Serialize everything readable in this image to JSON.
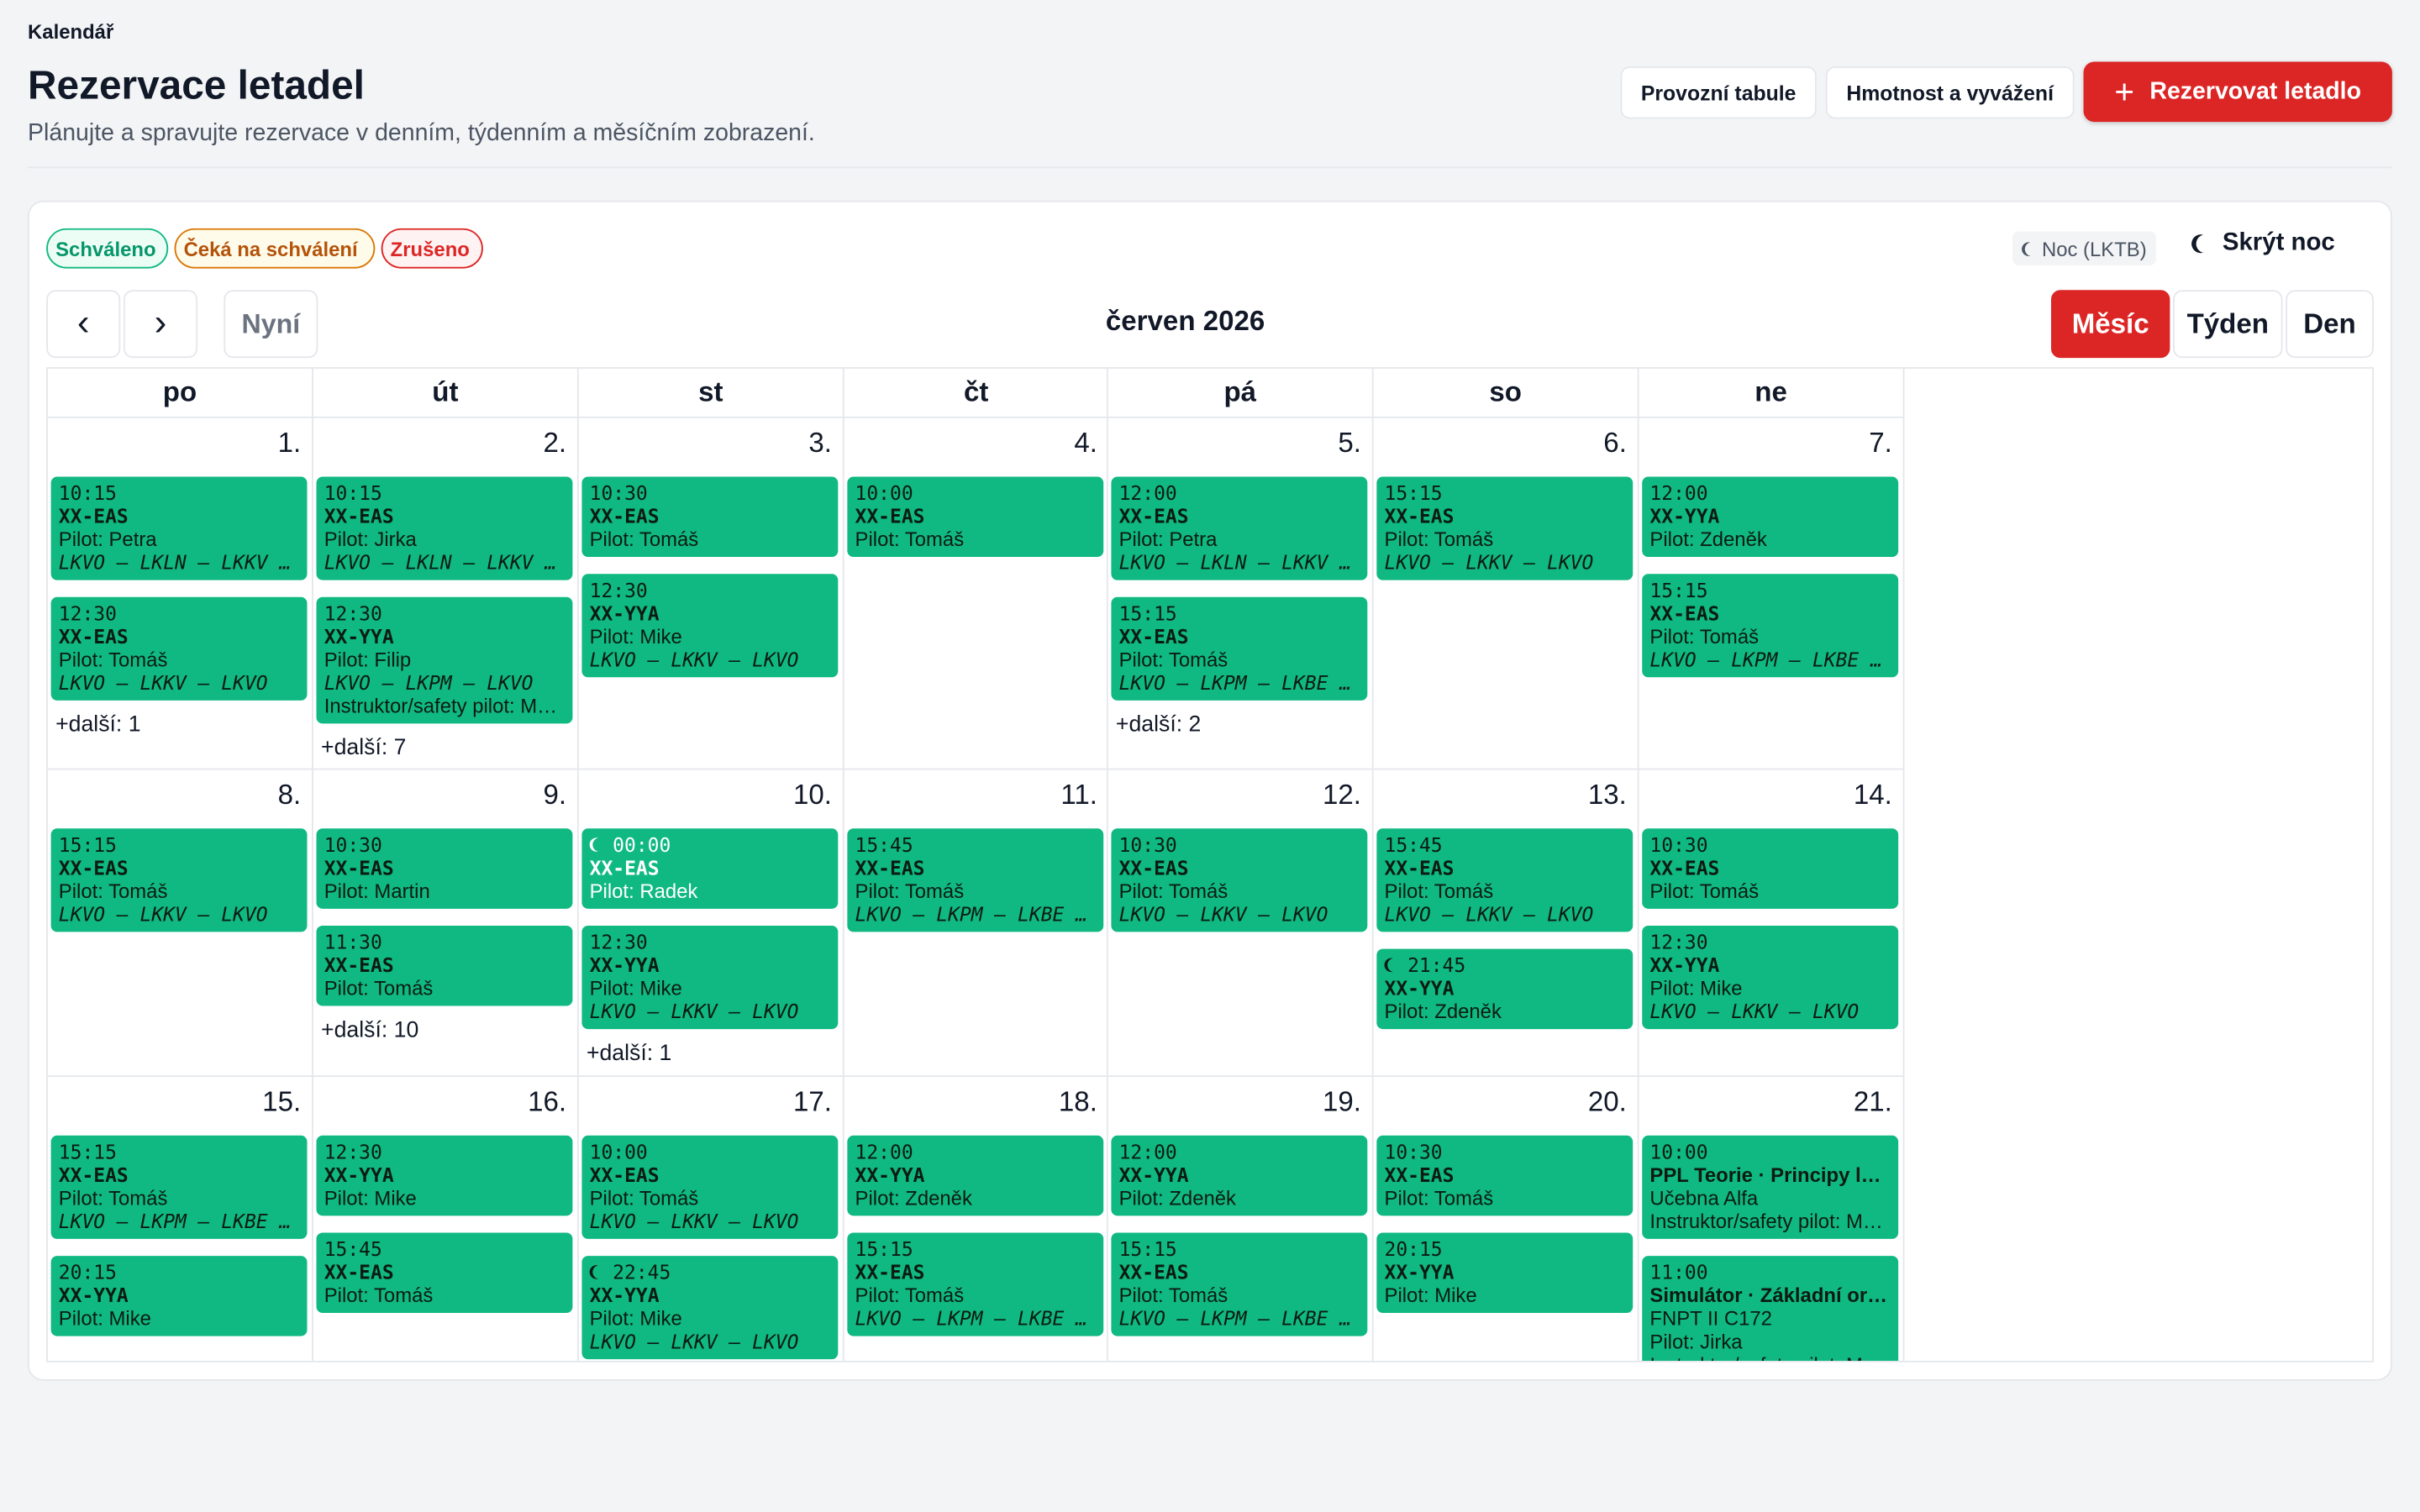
{
  "breadcrumb": "Kalendář",
  "header": {
    "title": "Rezervace letadel",
    "subtitle": "Plánujte a spravujte rezervace v denním, týdenním a měsíčním zobrazení.",
    "btn_board": "Provozní tabule",
    "btn_weight": "Hmotnost a vyvážení",
    "btn_book": "Rezervovat letadlo"
  },
  "legend": {
    "approved": "Schváleno",
    "pending": "Čeká na schválení",
    "cancelled": "Zrušeno",
    "night": "Noc (LKTB)",
    "hide_night": "Skrýt noc"
  },
  "toolbar": {
    "today": "Nyní",
    "month_label": "červen 2026",
    "view_month": "Měsíc",
    "view_week": "Týden",
    "view_day": "Den"
  },
  "colors": {
    "accent": "#dc2626",
    "event": "#10b981",
    "approved": "#059669",
    "pending": "#b45309",
    "cancelled": "#dc2626"
  },
  "days": [
    "po",
    "út",
    "st",
    "čt",
    "pá",
    "so",
    "ne"
  ],
  "weeks": [
    [
      {
        "num": "1.",
        "events": [
          {
            "time": "10:15",
            "plane": "XX-EAS",
            "pilot": "Pilot: Petra",
            "route": "LKVO – LKLN – LKKV – LKVO"
          },
          {
            "time": "12:30",
            "plane": "XX-EAS",
            "pilot": "Pilot: Tomáš",
            "route": "LKVO – LKKV – LKVO"
          }
        ],
        "more": "+další: 1"
      },
      {
        "num": "2.",
        "events": [
          {
            "time": "10:15",
            "plane": "XX-EAS",
            "pilot": "Pilot: Jirka",
            "route": "LKVO – LKLN – LKKV – LKVO"
          },
          {
            "time": "12:30",
            "plane": "XX-YYA",
            "pilot": "Pilot: Filip",
            "route": "LKVO – LKPM – LKVO",
            "extra": "Instruktor/safety pilot: Martin"
          }
        ],
        "more": "+další: 7"
      },
      {
        "num": "3.",
        "events": [
          {
            "time": "10:30",
            "plane": "XX-EAS",
            "pilot": "Pilot: Tomáš"
          },
          {
            "time": "12:30",
            "plane": "XX-YYA",
            "pilot": "Pilot: Mike",
            "route": "LKVO – LKKV – LKVO"
          }
        ]
      },
      {
        "num": "4.",
        "events": [
          {
            "time": "10:00",
            "plane": "XX-EAS",
            "pilot": "Pilot: Tomáš"
          }
        ]
      },
      {
        "num": "5.",
        "events": [
          {
            "time": "12:00",
            "plane": "XX-EAS",
            "pilot": "Pilot: Petra",
            "route": "LKVO – LKLN – LKKV – LKVO"
          },
          {
            "time": "15:15",
            "plane": "XX-EAS",
            "pilot": "Pilot: Tomáš",
            "route": "LKVO – LKPM – LKBE – LKVO"
          }
        ],
        "more": "+další: 2"
      },
      {
        "num": "6.",
        "events": [
          {
            "time": "15:15",
            "plane": "XX-EAS",
            "pilot": "Pilot: Tomáš",
            "route": "LKVO – LKKV – LKVO"
          }
        ]
      },
      {
        "num": "7.",
        "events": [
          {
            "time": "12:00",
            "plane": "XX-YYA",
            "pilot": "Pilot: Zdeněk"
          },
          {
            "time": "15:15",
            "plane": "XX-EAS",
            "pilot": "Pilot: Tomáš",
            "route": "LKVO – LKPM – LKBE – LKVO"
          }
        ]
      }
    ],
    [
      {
        "num": "8.",
        "events": [
          {
            "time": "15:15",
            "plane": "XX-EAS",
            "pilot": "Pilot: Tomáš",
            "route": "LKVO – LKKV – LKVO"
          }
        ]
      },
      {
        "num": "9.",
        "events": [
          {
            "time": "10:30",
            "plane": "XX-EAS",
            "pilot": "Pilot: Martin"
          },
          {
            "time": "11:30",
            "plane": "XX-EAS",
            "pilot": "Pilot: Tomáš"
          }
        ],
        "more": "+další: 10"
      },
      {
        "num": "10.",
        "events": [
          {
            "time": "00:00",
            "plane": "XX-EAS",
            "pilot": "Pilot: Radek",
            "night": true
          },
          {
            "time": "12:30",
            "plane": "XX-YYA",
            "pilot": "Pilot: Mike",
            "route": "LKVO – LKKV – LKVO"
          }
        ],
        "more": "+další: 1"
      },
      {
        "num": "11.",
        "events": [
          {
            "time": "15:45",
            "plane": "XX-EAS",
            "pilot": "Pilot: Tomáš",
            "route": "LKVO – LKPM – LKBE – LKVO"
          }
        ]
      },
      {
        "num": "12.",
        "events": [
          {
            "time": "10:30",
            "plane": "XX-EAS",
            "pilot": "Pilot: Tomáš",
            "route": "LKVO – LKKV – LKVO"
          }
        ]
      },
      {
        "num": "13.",
        "events": [
          {
            "time": "15:45",
            "plane": "XX-EAS",
            "pilot": "Pilot: Tomáš",
            "route": "LKVO – LKKV – LKVO"
          },
          {
            "time": "21:45",
            "plane": "XX-YYA",
            "pilot": "Pilot: Zdeněk",
            "moon": true
          }
        ]
      },
      {
        "num": "14.",
        "events": [
          {
            "time": "10:30",
            "plane": "XX-EAS",
            "pilot": "Pilot: Tomáš"
          },
          {
            "time": "12:30",
            "plane": "XX-YYA",
            "pilot": "Pilot: Mike",
            "route": "LKVO – LKKV – LKVO"
          }
        ]
      }
    ],
    [
      {
        "num": "15.",
        "events": [
          {
            "time": "15:15",
            "plane": "XX-EAS",
            "pilot": "Pilot: Tomáš",
            "route": "LKVO – LKPM – LKBE – LKVO"
          },
          {
            "time": "20:15",
            "plane": "XX-YYA",
            "pilot": "Pilot: Mike"
          }
        ]
      },
      {
        "num": "16.",
        "events": [
          {
            "time": "12:30",
            "plane": "XX-YYA",
            "pilot": "Pilot: Mike"
          },
          {
            "time": "15:45",
            "plane": "XX-EAS",
            "pilot": "Pilot: Tomáš"
          }
        ]
      },
      {
        "num": "17.",
        "events": [
          {
            "time": "10:00",
            "plane": "XX-EAS",
            "pilot": "Pilot: Tomáš",
            "route": "LKVO – LKKV – LKVO"
          },
          {
            "time": "22:45",
            "plane": "XX-YYA",
            "pilot": "Pilot: Mike",
            "route": "LKVO – LKKV – LKVO",
            "moon": true
          }
        ]
      },
      {
        "num": "18.",
        "events": [
          {
            "time": "12:00",
            "plane": "XX-YYA",
            "pilot": "Pilot: Zdeněk"
          },
          {
            "time": "15:15",
            "plane": "XX-EAS",
            "pilot": "Pilot: Tomáš",
            "route": "LKVO – LKPM – LKBE – LKVO"
          }
        ]
      },
      {
        "num": "19.",
        "events": [
          {
            "time": "12:00",
            "plane": "XX-YYA",
            "pilot": "Pilot: Zdeněk"
          },
          {
            "time": "15:15",
            "plane": "XX-EAS",
            "pilot": "Pilot: Tomáš",
            "route": "LKVO – LKPM – LKBE – LKVO"
          }
        ]
      },
      {
        "num": "20.",
        "events": [
          {
            "time": "10:30",
            "plane": "XX-EAS",
            "pilot": "Pilot: Tomáš"
          },
          {
            "time": "20:15",
            "plane": "XX-YYA",
            "pilot": "Pilot: Mike"
          }
        ]
      },
      {
        "num": "21.",
        "events": [
          {
            "time": "10:00",
            "course": "PPL Teorie · Principy letu",
            "line1": "Učebna Alfa",
            "line2": "Instruktor/safety pilot: Martin"
          },
          {
            "time": "11:00",
            "course": "Simulátor · Základní orientace",
            "line1": "FNPT II C172",
            "line2": "Pilot: Jirka",
            "line3": "Instruktor/safety pilot: Martin"
          }
        ]
      }
    ]
  ]
}
